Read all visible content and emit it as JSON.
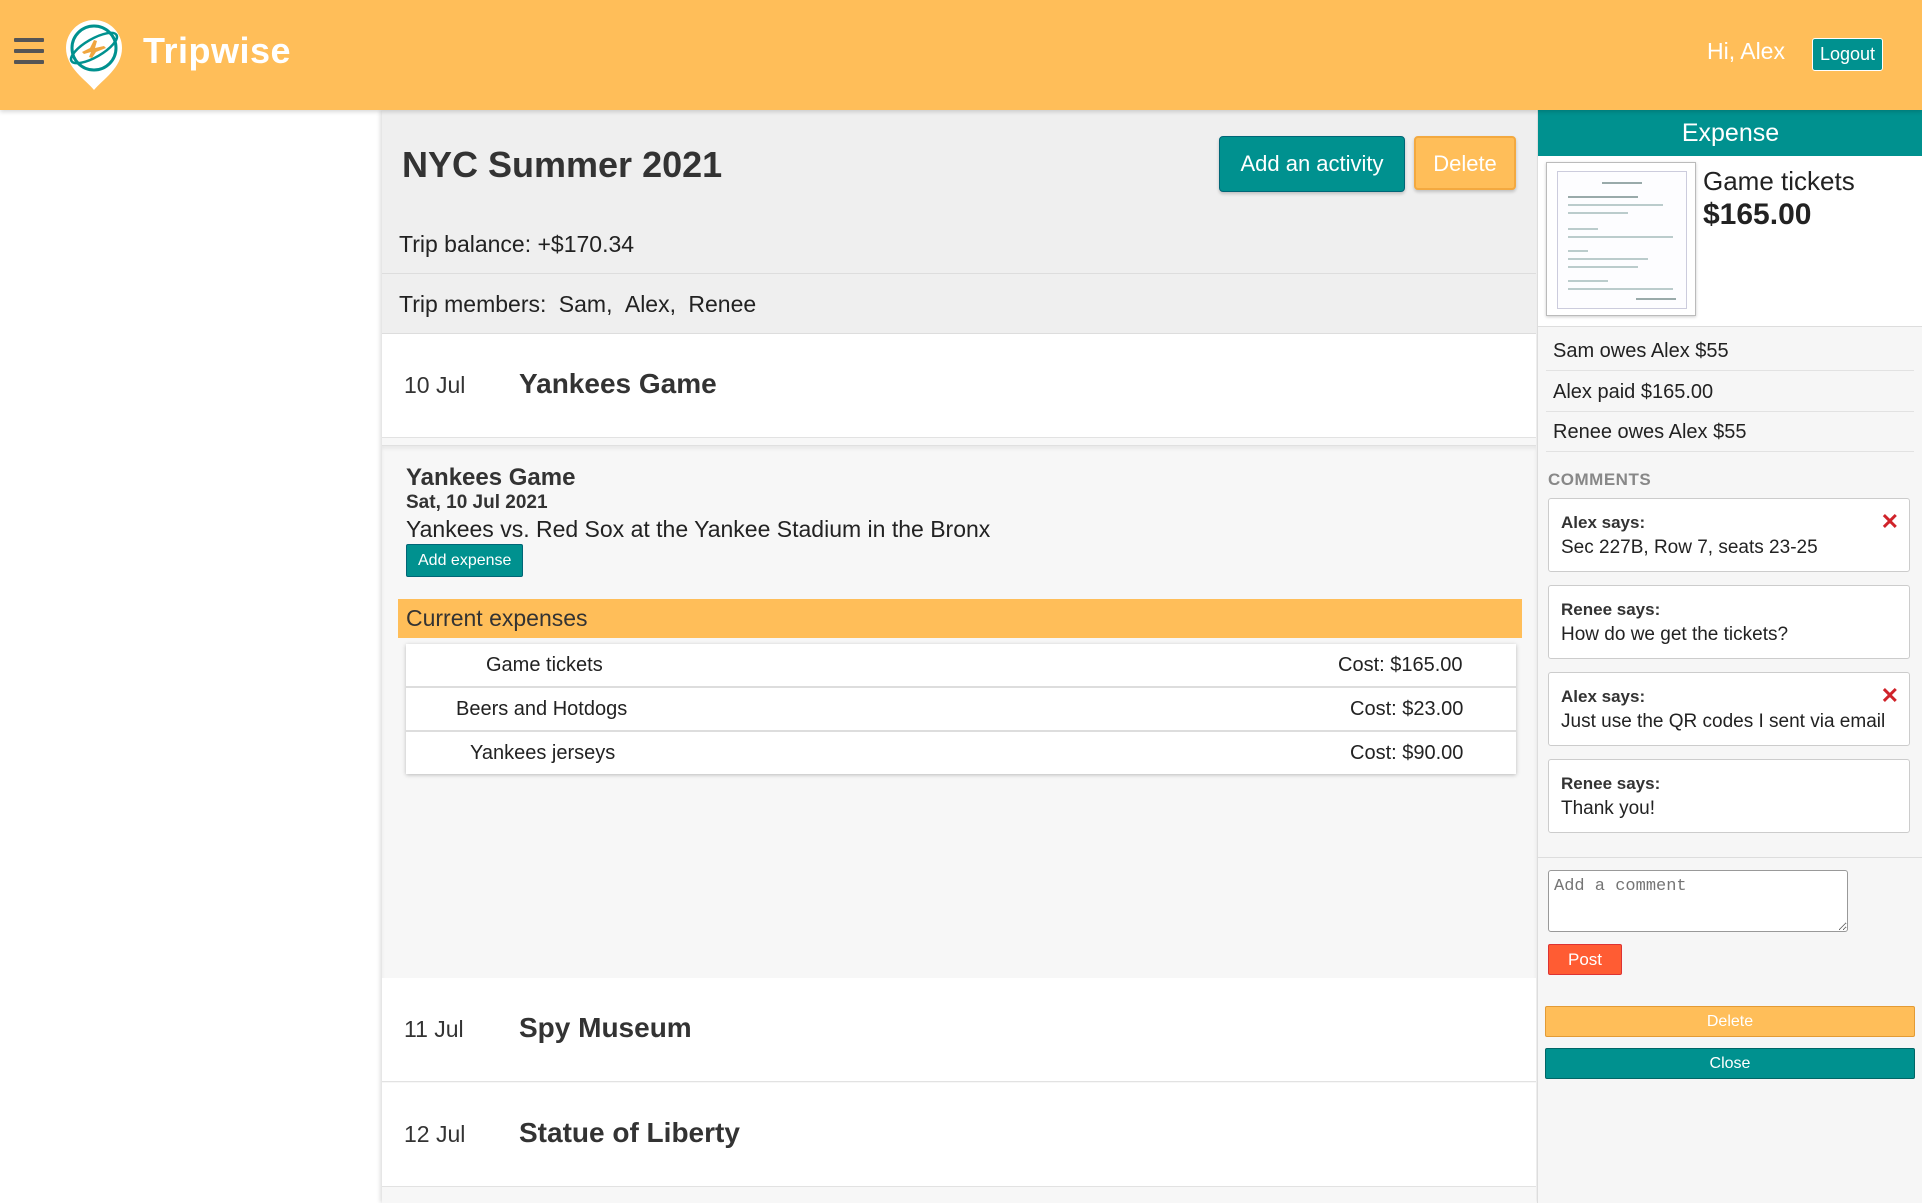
{
  "header": {
    "brand": "Tripwise",
    "greeting": "Hi, Alex",
    "logout_label": "Logout",
    "brand_color": "#ffbe59",
    "accent_color": "#00918f"
  },
  "trip": {
    "title": "NYC Summer 2021",
    "add_activity_label": "Add an activity",
    "delete_label": "Delete",
    "balance": "Trip balance: +$170.34",
    "members_label": "Trip members:",
    "members": [
      "Sam,",
      "Alex,",
      "Renee"
    ]
  },
  "activities": [
    {
      "date": "10 Jul",
      "name": "Yankees Game"
    },
    {
      "date": "11 Jul",
      "name": "Spy Museum"
    },
    {
      "date": "12 Jul",
      "name": "Statue of Liberty"
    }
  ],
  "activity_detail": {
    "title": "Yankees Game",
    "date": "Sat, 10 Jul 2021",
    "description": "Yankees vs. Red Sox at the Yankee Stadium in the Bronx",
    "add_expense_label": "Add expense",
    "expenses_header": "Current expenses",
    "expenses": [
      {
        "name": "Game tickets",
        "cost": "Cost: $165.00"
      },
      {
        "name": "Beers and Hotdogs",
        "cost": "Cost: $23.00"
      },
      {
        "name": "Yankees jerseys",
        "cost": "Cost: $90.00"
      }
    ]
  },
  "expense_panel": {
    "heading": "Expense",
    "expense_title": "Game tickets",
    "expense_amount": "$165.00",
    "balances": [
      "Sam owes Alex $55",
      "Alex paid $165.00",
      "Renee owes Alex $55"
    ],
    "comments_label": "COMMENTS",
    "comments": [
      {
        "author": "Alex says:",
        "text": "Sec 227B, Row 7, seats 23-25",
        "deletable": true
      },
      {
        "author": "Renee says:",
        "text": "How do we get the tickets?",
        "deletable": false
      },
      {
        "author": "Alex says:",
        "text": "Just use the QR codes I sent via email",
        "deletable": true
      },
      {
        "author": "Renee says:",
        "text": "Thank you!",
        "deletable": false
      }
    ],
    "comment_placeholder": "Add a comment",
    "post_label": "Post",
    "delete_label": "Delete",
    "close_label": "Close",
    "delete_glyph": "✕"
  }
}
